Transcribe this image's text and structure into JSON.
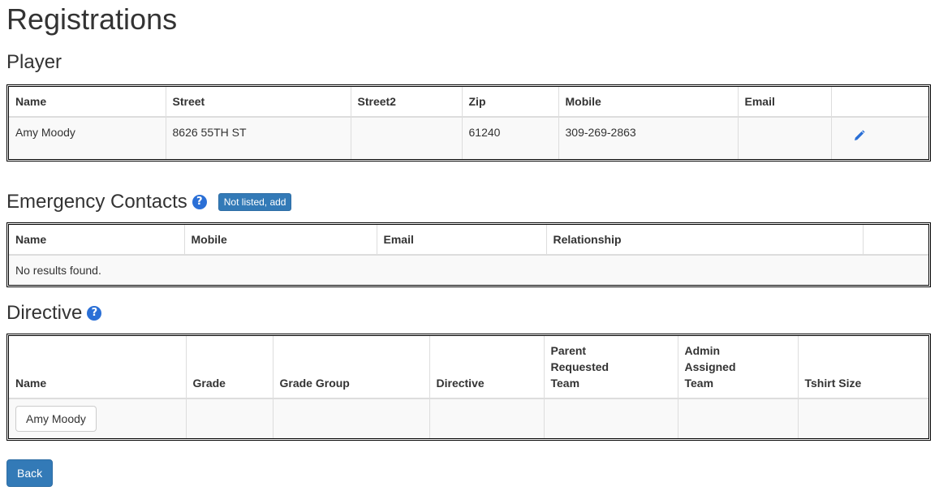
{
  "page_title": "Registrations",
  "player": {
    "section_title": "Player",
    "columns": [
      "Name",
      "Street",
      "Street2",
      "Zip",
      "Mobile",
      "Email",
      ""
    ],
    "rows": [
      {
        "name": "Amy Moody",
        "street": "8626 55TH ST",
        "street2": "",
        "zip": "61240",
        "mobile": "309-269-2863",
        "email": ""
      }
    ],
    "edit_icon": "pencil-icon"
  },
  "emergency_contacts": {
    "section_title": "Emergency Contacts",
    "help_icon": "question-circle-icon",
    "add_label": "Not listed, add",
    "columns": [
      "Name",
      "Mobile",
      "Email",
      "Relationship",
      ""
    ],
    "empty_text": "No results found."
  },
  "directive": {
    "section_title": "Directive",
    "help_icon": "question-circle-icon",
    "columns": [
      "Name",
      "Grade",
      "Grade Group",
      "Directive",
      "Parent Requested Team",
      "Admin Assigned Team",
      "Tshirt Size"
    ],
    "rows": [
      {
        "name": "Amy Moody",
        "grade": "",
        "grade_group": "",
        "directive": "",
        "parent_requested_team": "",
        "admin_assigned_team": "",
        "tshirt_size": ""
      }
    ]
  },
  "back_label": "Back",
  "colors": {
    "primary": "#337ab7",
    "help_icon": "#2a6fd6",
    "pencil": "#2a6fd6"
  }
}
